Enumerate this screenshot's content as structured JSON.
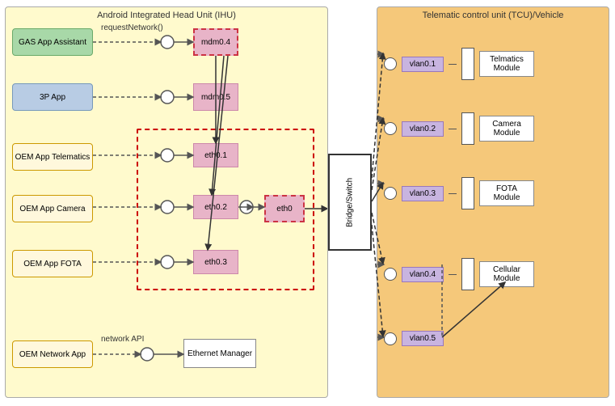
{
  "ihu": {
    "title": "Android Integrated Head Unit (IHU)",
    "apps": [
      {
        "id": "gas-app",
        "label": "GAS App Assistant",
        "type": "green"
      },
      {
        "id": "3p-app",
        "label": "3P App",
        "type": "blue"
      },
      {
        "id": "oem-telematics",
        "label": "OEM App Telematics",
        "type": "yellow"
      },
      {
        "id": "oem-camera",
        "label": "OEM App Camera",
        "type": "yellow"
      },
      {
        "id": "oem-fota",
        "label": "OEM App FOTA",
        "type": "yellow"
      },
      {
        "id": "oem-network",
        "label": "OEM Network App",
        "type": "yellow"
      }
    ],
    "interfaces": [
      {
        "id": "mdm04",
        "label": "mdm0.4",
        "dashed": true
      },
      {
        "id": "mdm05",
        "label": "mdm0.5",
        "dashed": false
      },
      {
        "id": "eth01",
        "label": "eth0.1",
        "dashed": false
      },
      {
        "id": "eth02",
        "label": "eth0.2",
        "dashed": false
      },
      {
        "id": "eth03",
        "label": "eth0.3",
        "dashed": false
      },
      {
        "id": "eth0",
        "label": "eth0",
        "dashed": true
      }
    ],
    "annotations": [
      {
        "id": "request-network",
        "label": "requestNetwork()"
      },
      {
        "id": "network-api",
        "label": "network API"
      }
    ],
    "eth_manager": "Ethernet Manager"
  },
  "bridge": {
    "label": "Bridge/Switch"
  },
  "tcu": {
    "title": "Telematic control unit (TCU)/Vehicle",
    "vlans": [
      {
        "id": "vlan01",
        "label": "vlan0.1"
      },
      {
        "id": "vlan02",
        "label": "vlan0.2"
      },
      {
        "id": "vlan03",
        "label": "vlan0.3"
      },
      {
        "id": "vlan04",
        "label": "vlan0.4"
      },
      {
        "id": "vlan05",
        "label": "vlan0.5"
      }
    ],
    "modules": [
      {
        "id": "telmatics",
        "label": "Telmatics\nModule"
      },
      {
        "id": "camera",
        "label": "Camera\nModule"
      },
      {
        "id": "fota",
        "label": "FOTA\nModule"
      },
      {
        "id": "cellular",
        "label": "Cellular\nModule"
      }
    ]
  },
  "colors": {
    "ihu_bg": "#fffacd",
    "tcu_bg": "#f5c87a",
    "green_app": "#a8d8a8",
    "blue_app": "#b8cce4",
    "yellow_app": "#fff8dc",
    "pink_iface": "#e8b4c8",
    "dashed_red": "#cc0000"
  }
}
